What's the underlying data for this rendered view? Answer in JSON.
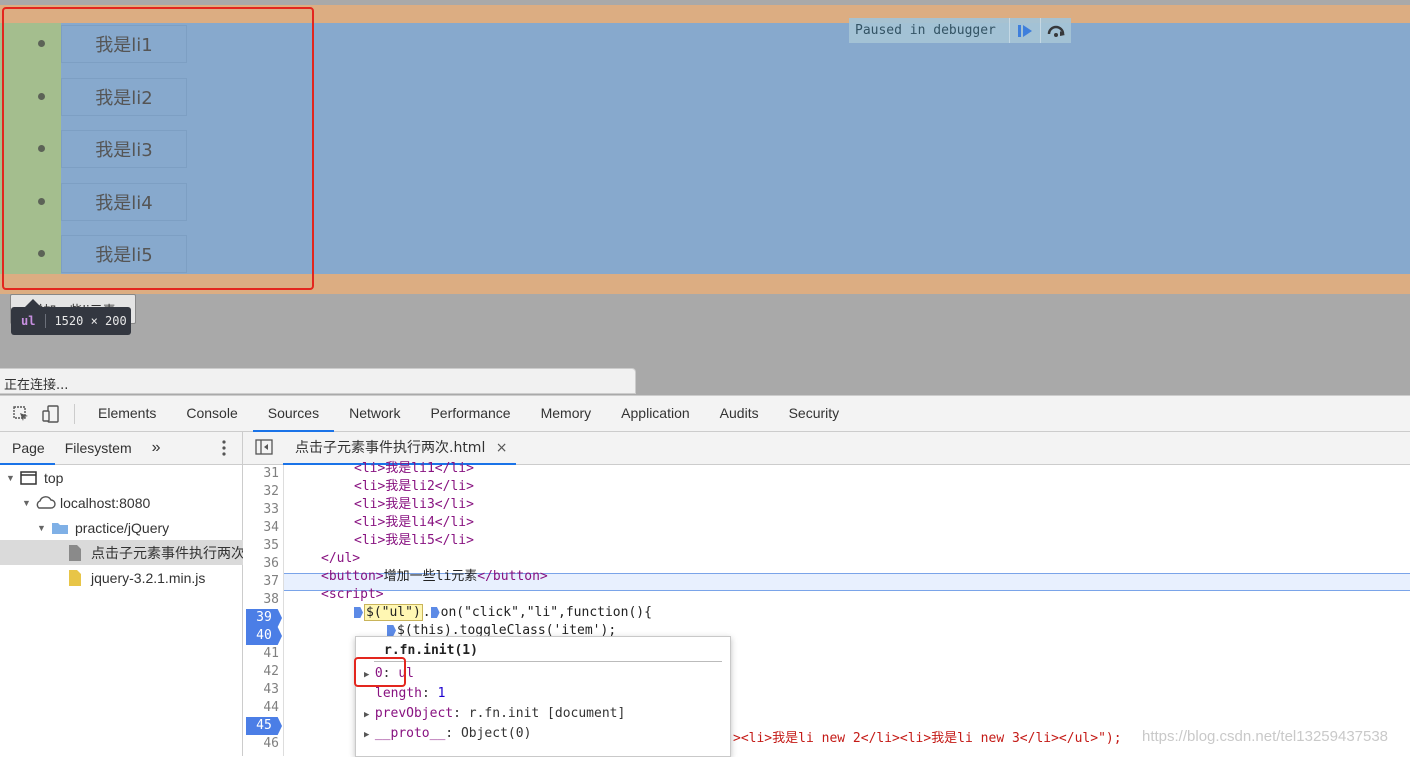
{
  "page": {
    "list_items": [
      "我是li1",
      "我是li2",
      "我是li3",
      "我是li4",
      "我是li5"
    ],
    "button_label": "增加一些li元素",
    "status_text": "正在连接..."
  },
  "debugger": {
    "paused_text": "Paused in debugger"
  },
  "tooltip": {
    "tag": "ul",
    "size": "1520 × 200"
  },
  "devtools": {
    "tabs": [
      "Elements",
      "Console",
      "Sources",
      "Network",
      "Performance",
      "Memory",
      "Application",
      "Audits",
      "Security"
    ],
    "active_tab": "Sources",
    "navigator": {
      "tabs": [
        "Page",
        "Filesystem"
      ],
      "more": "»",
      "tree": [
        "top",
        "localhost:8080",
        "practice/jQuery",
        "点击子元素事件执行两次.html",
        "jquery-3.2.1.min.js"
      ]
    },
    "editor": {
      "file_tab": "点击子元素事件执行两次.html",
      "close_glyph": "×",
      "line_numbers": [
        "31",
        "32",
        "33",
        "34",
        "35",
        "36",
        "37",
        "38",
        "39",
        "40",
        "41",
        "42",
        "43",
        "44",
        "45",
        "46"
      ],
      "breakpoint_lines": [
        "39",
        "40",
        "45"
      ],
      "code": {
        "l31": "<li>我是li1</li>",
        "l32": "<li>我是li2</li>",
        "l33": "<li>我是li3</li>",
        "l34": "<li>我是li4</li>",
        "l35": "<li>我是li5</li>",
        "l36": "</ul>",
        "l37_open": "<button>",
        "l37_text": "增加一些li元素",
        "l37_close": "</button>",
        "l38": "<script>",
        "l39_a": "$(\"ul\")",
        "l39_b": ".",
        "l39_c": "on(\"click\",\"li\",function(){",
        "l40": "$(this).toggleClass('item');",
        "l46": "><li>我是li new 2</li><li>我是li new 3</li></ul>\");"
      }
    },
    "popover": {
      "title": "r.fn.init(1)",
      "props": [
        {
          "name": "0",
          "value": "ul"
        },
        {
          "name": "length",
          "value": "1"
        },
        {
          "name": "prevObject",
          "value": "r.fn.init [document]"
        },
        {
          "name": "__proto__",
          "value": "Object(0)"
        }
      ]
    }
  },
  "watermark": "https://blog.csdn.net/tel13259437538"
}
